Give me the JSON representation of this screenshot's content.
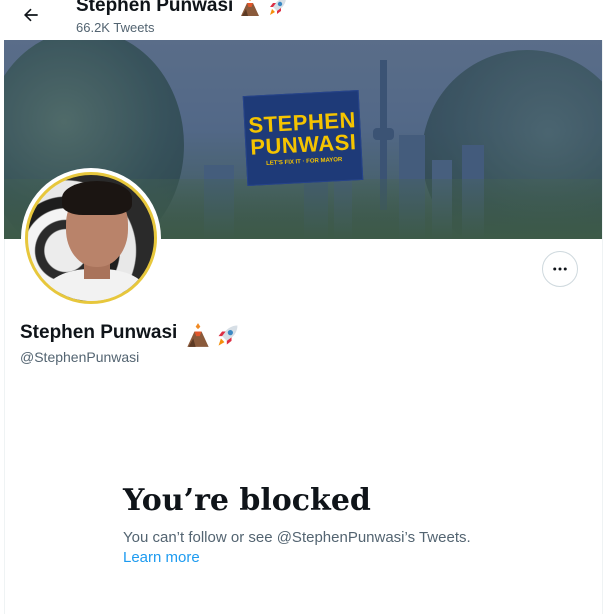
{
  "header": {
    "title": "Stephen Punwasi",
    "tweet_count": "66.2K Tweets",
    "title_emojis": [
      "volcano-icon",
      "rocket-icon"
    ]
  },
  "banner": {
    "sign_line1": "STEPHEN",
    "sign_line2": "PUNWASI",
    "sign_tagline": "LET'S FIX IT · FOR MAYOR"
  },
  "profile": {
    "name": "Stephen Punwasi",
    "handle": "@StephenPunwasi",
    "name_emojis": [
      "volcano-icon",
      "rocket-icon"
    ]
  },
  "blocked": {
    "title": "You’re blocked",
    "description": "You can’t follow or see @StephenPunwasi’s Tweets.",
    "learn_more": "Learn more"
  },
  "colors": {
    "accent": "#1d9bf0",
    "secondary_text": "#536471",
    "sign_bg": "#1e3a78",
    "sign_text": "#f5c400"
  }
}
